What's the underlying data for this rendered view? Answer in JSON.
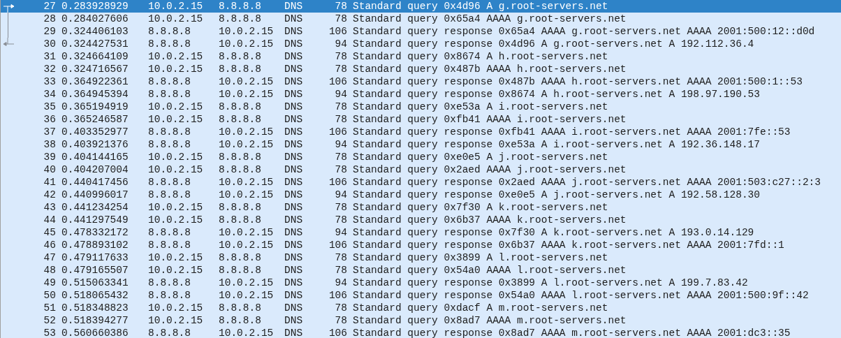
{
  "packets": [
    {
      "no": "27",
      "time": "0.283928929",
      "source": "10.0.2.15",
      "destination": "8.8.8.8",
      "protocol": "DNS",
      "length": "78",
      "info": "Standard query 0x4d96 A g.root-servers.net",
      "selected": true,
      "kind": "request"
    },
    {
      "no": "28",
      "time": "0.284027606",
      "source": "10.0.2.15",
      "destination": "8.8.8.8",
      "protocol": "DNS",
      "length": "78",
      "info": "Standard query 0x65a4 AAAA g.root-servers.net",
      "selected": false,
      "kind": "between"
    },
    {
      "no": "29",
      "time": "0.324406103",
      "source": "8.8.8.8",
      "destination": "10.0.2.15",
      "protocol": "DNS",
      "length": "106",
      "info": "Standard query response 0x65a4 AAAA g.root-servers.net AAAA 2001:500:12::d0d",
      "selected": false,
      "kind": "between"
    },
    {
      "no": "30",
      "time": "0.324427531",
      "source": "8.8.8.8",
      "destination": "10.0.2.15",
      "protocol": "DNS",
      "length": "94",
      "info": "Standard query response 0x4d96 A g.root-servers.net A 192.112.36.4",
      "selected": false,
      "kind": "response"
    },
    {
      "no": "31",
      "time": "0.324664109",
      "source": "10.0.2.15",
      "destination": "8.8.8.8",
      "protocol": "DNS",
      "length": "78",
      "info": "Standard query 0x8674 A h.root-servers.net",
      "selected": false
    },
    {
      "no": "32",
      "time": "0.324716567",
      "source": "10.0.2.15",
      "destination": "8.8.8.8",
      "protocol": "DNS",
      "length": "78",
      "info": "Standard query 0x487b AAAA h.root-servers.net",
      "selected": false
    },
    {
      "no": "33",
      "time": "0.364922361",
      "source": "8.8.8.8",
      "destination": "10.0.2.15",
      "protocol": "DNS",
      "length": "106",
      "info": "Standard query response 0x487b AAAA h.root-servers.net AAAA 2001:500:1::53",
      "selected": false
    },
    {
      "no": "34",
      "time": "0.364945394",
      "source": "8.8.8.8",
      "destination": "10.0.2.15",
      "protocol": "DNS",
      "length": "94",
      "info": "Standard query response 0x8674 A h.root-servers.net A 198.97.190.53",
      "selected": false
    },
    {
      "no": "35",
      "time": "0.365194919",
      "source": "10.0.2.15",
      "destination": "8.8.8.8",
      "protocol": "DNS",
      "length": "78",
      "info": "Standard query 0xe53a A i.root-servers.net",
      "selected": false
    },
    {
      "no": "36",
      "time": "0.365246587",
      "source": "10.0.2.15",
      "destination": "8.8.8.8",
      "protocol": "DNS",
      "length": "78",
      "info": "Standard query 0xfb41 AAAA i.root-servers.net",
      "selected": false
    },
    {
      "no": "37",
      "time": "0.403352977",
      "source": "8.8.8.8",
      "destination": "10.0.2.15",
      "protocol": "DNS",
      "length": "106",
      "info": "Standard query response 0xfb41 AAAA i.root-servers.net AAAA 2001:7fe::53",
      "selected": false
    },
    {
      "no": "38",
      "time": "0.403921376",
      "source": "8.8.8.8",
      "destination": "10.0.2.15",
      "protocol": "DNS",
      "length": "94",
      "info": "Standard query response 0xe53a A i.root-servers.net A 192.36.148.17",
      "selected": false
    },
    {
      "no": "39",
      "time": "0.404144165",
      "source": "10.0.2.15",
      "destination": "8.8.8.8",
      "protocol": "DNS",
      "length": "78",
      "info": "Standard query 0xe0e5 A j.root-servers.net",
      "selected": false
    },
    {
      "no": "40",
      "time": "0.404207004",
      "source": "10.0.2.15",
      "destination": "8.8.8.8",
      "protocol": "DNS",
      "length": "78",
      "info": "Standard query 0x2aed AAAA j.root-servers.net",
      "selected": false
    },
    {
      "no": "41",
      "time": "0.440417456",
      "source": "8.8.8.8",
      "destination": "10.0.2.15",
      "protocol": "DNS",
      "length": "106",
      "info": "Standard query response 0x2aed AAAA j.root-servers.net AAAA 2001:503:c27::2:3",
      "selected": false
    },
    {
      "no": "42",
      "time": "0.440996017",
      "source": "8.8.8.8",
      "destination": "10.0.2.15",
      "protocol": "DNS",
      "length": "94",
      "info": "Standard query response 0xe0e5 A j.root-servers.net A 192.58.128.30",
      "selected": false
    },
    {
      "no": "43",
      "time": "0.441234254",
      "source": "10.0.2.15",
      "destination": "8.8.8.8",
      "protocol": "DNS",
      "length": "78",
      "info": "Standard query 0x7f30 A k.root-servers.net",
      "selected": false
    },
    {
      "no": "44",
      "time": "0.441297549",
      "source": "10.0.2.15",
      "destination": "8.8.8.8",
      "protocol": "DNS",
      "length": "78",
      "info": "Standard query 0x6b37 AAAA k.root-servers.net",
      "selected": false
    },
    {
      "no": "45",
      "time": "0.478332172",
      "source": "8.8.8.8",
      "destination": "10.0.2.15",
      "protocol": "DNS",
      "length": "94",
      "info": "Standard query response 0x7f30 A k.root-servers.net A 193.0.14.129",
      "selected": false
    },
    {
      "no": "46",
      "time": "0.478893102",
      "source": "8.8.8.8",
      "destination": "10.0.2.15",
      "protocol": "DNS",
      "length": "106",
      "info": "Standard query response 0x6b37 AAAA k.root-servers.net AAAA 2001:7fd::1",
      "selected": false
    },
    {
      "no": "47",
      "time": "0.479117633",
      "source": "10.0.2.15",
      "destination": "8.8.8.8",
      "protocol": "DNS",
      "length": "78",
      "info": "Standard query 0x3899 A l.root-servers.net",
      "selected": false
    },
    {
      "no": "48",
      "time": "0.479165507",
      "source": "10.0.2.15",
      "destination": "8.8.8.8",
      "protocol": "DNS",
      "length": "78",
      "info": "Standard query 0x54a0 AAAA l.root-servers.net",
      "selected": false
    },
    {
      "no": "49",
      "time": "0.515063341",
      "source": "8.8.8.8",
      "destination": "10.0.2.15",
      "protocol": "DNS",
      "length": "94",
      "info": "Standard query response 0x3899 A l.root-servers.net A 199.7.83.42",
      "selected": false
    },
    {
      "no": "50",
      "time": "0.518065432",
      "source": "8.8.8.8",
      "destination": "10.0.2.15",
      "protocol": "DNS",
      "length": "106",
      "info": "Standard query response 0x54a0 AAAA l.root-servers.net AAAA 2001:500:9f::42",
      "selected": false
    },
    {
      "no": "51",
      "time": "0.518348823",
      "source": "10.0.2.15",
      "destination": "8.8.8.8",
      "protocol": "DNS",
      "length": "78",
      "info": "Standard query 0xdacf A m.root-servers.net",
      "selected": false
    },
    {
      "no": "52",
      "time": "0.518394277",
      "source": "10.0.2.15",
      "destination": "8.8.8.8",
      "protocol": "DNS",
      "length": "78",
      "info": "Standard query 0x8ad7 AAAA m.root-servers.net",
      "selected": false
    },
    {
      "no": "53",
      "time": "0.560660386",
      "source": "8.8.8.8",
      "destination": "10.0.2.15",
      "protocol": "DNS",
      "length": "106",
      "info": "Standard query response 0x8ad7 AAAA m.root-servers.net AAAA 2001:dc3::35",
      "selected": false
    }
  ]
}
